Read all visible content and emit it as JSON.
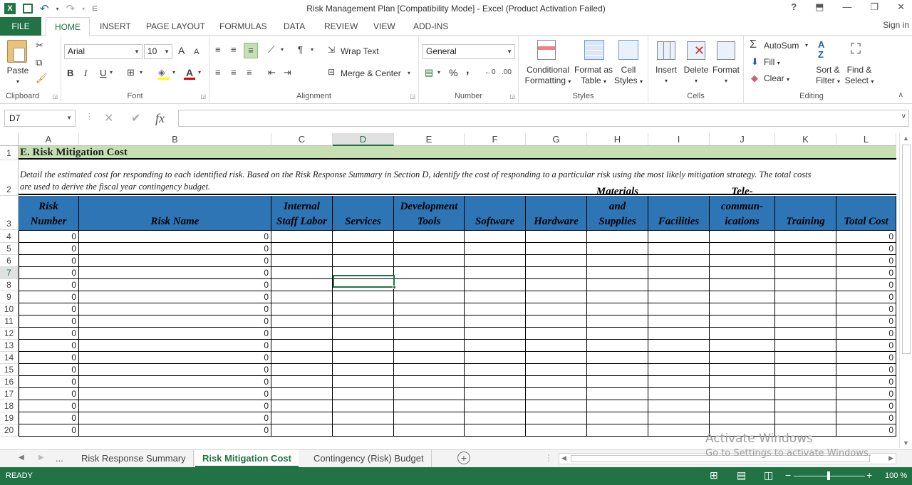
{
  "app": {
    "window_title": "Risk Management Plan  [Compatibility Mode] - Excel (Product Activation Failed)",
    "help": "?",
    "sign_in": "Sign in"
  },
  "ribbon_tabs": [
    "FILE",
    "HOME",
    "INSERT",
    "PAGE LAYOUT",
    "FORMULAS",
    "DATA",
    "REVIEW",
    "VIEW",
    "ADD-INS"
  ],
  "ribbon": {
    "clipboard": {
      "paste": "Paste",
      "label": "Clipboard"
    },
    "font": {
      "name": "Arial",
      "size": "10",
      "bold": "B",
      "italic": "I",
      "underline": "U",
      "grow": "A",
      "shrink": "A",
      "label": "Font"
    },
    "alignment": {
      "wrap_text": "Wrap Text",
      "merge_center": "Merge & Center",
      "label": "Alignment"
    },
    "number": {
      "format": "General",
      "percent": "%",
      "comma": ",",
      "label": "Number"
    },
    "styles": {
      "conditional": "Conditional",
      "formatting": "Formatting",
      "format_as": "Format as",
      "table": "Table",
      "cell": "Cell",
      "cell_styles": "Styles",
      "label": "Styles"
    },
    "cells": {
      "insert": "Insert",
      "delete": "Delete",
      "format": "Format",
      "label": "Cells"
    },
    "editing": {
      "autosum": "AutoSum",
      "fill": "Fill",
      "clear": "Clear",
      "sort": "Sort &",
      "filter": "Filter",
      "find": "Find &",
      "select": "Select",
      "label": "Editing"
    }
  },
  "formula_bar": {
    "name_box": "D7",
    "fx": "fx",
    "formula": ""
  },
  "columns": [
    "A",
    "B",
    "C",
    "D",
    "E",
    "F",
    "G",
    "H",
    "I",
    "J",
    "K",
    "L"
  ],
  "selected_column": "D",
  "sheet": {
    "title": "E.  Risk Mitigation Cost",
    "description_line1": "Detail the estimated cost for responding to each identified risk.  Based on the Risk Response Summary in Section D, identify the cost of responding to a particular risk using the most likely mitigation strategy.  The total costs",
    "description_line2": "are used to derive the fiscal year contingency budget.",
    "headers": [
      [
        "Risk",
        "Number"
      ],
      [
        "Risk Name"
      ],
      [
        "Internal",
        "Staff Labor"
      ],
      [
        "Services"
      ],
      [
        "Development",
        "Tools"
      ],
      [
        "Software"
      ],
      [
        "Hardware"
      ],
      [
        "Materials",
        "and",
        "Supplies"
      ],
      [
        "Facilities"
      ],
      [
        "Tele-",
        "commun-",
        "ications"
      ],
      [
        "Training"
      ],
      [
        "Total Cost"
      ]
    ],
    "rows": [
      {
        "num": "4",
        "a": "0",
        "b": "0",
        "l": "0"
      },
      {
        "num": "5",
        "a": "0",
        "b": "0",
        "l": "0"
      },
      {
        "num": "6",
        "a": "0",
        "b": "0",
        "l": "0"
      },
      {
        "num": "7",
        "a": "0",
        "b": "0",
        "l": "0"
      },
      {
        "num": "8",
        "a": "0",
        "b": "0",
        "l": "0"
      },
      {
        "num": "9",
        "a": "0",
        "b": "0",
        "l": "0"
      },
      {
        "num": "10",
        "a": "0",
        "b": "0",
        "l": "0"
      },
      {
        "num": "11",
        "a": "0",
        "b": "0",
        "l": "0"
      },
      {
        "num": "12",
        "a": "0",
        "b": "0",
        "l": "0"
      },
      {
        "num": "13",
        "a": "0",
        "b": "0",
        "l": "0"
      },
      {
        "num": "14",
        "a": "0",
        "b": "0",
        "l": "0"
      },
      {
        "num": "15",
        "a": "0",
        "b": "0",
        "l": "0"
      },
      {
        "num": "16",
        "a": "0",
        "b": "0",
        "l": "0"
      },
      {
        "num": "17",
        "a": "0",
        "b": "0",
        "l": "0"
      },
      {
        "num": "18",
        "a": "0",
        "b": "0",
        "l": "0"
      },
      {
        "num": "19",
        "a": "0",
        "b": "0",
        "l": "0"
      },
      {
        "num": "20",
        "a": "0",
        "b": "0",
        "l": "0"
      }
    ],
    "row_labels_top": [
      "1",
      "2",
      "3"
    ],
    "active_row": "7"
  },
  "sheet_tabs": {
    "ellipsis": "...",
    "tabs": [
      "Risk Response Summary",
      "Risk Mitigation Cost",
      "Contingency (Risk) Budget"
    ],
    "active": "Risk Mitigation Cost"
  },
  "status": {
    "ready": "READY",
    "zoom": "100 %"
  },
  "watermark": {
    "line1": "Activate Windows",
    "line2": "Go to Settings to activate Windows."
  },
  "colors": {
    "excel_green": "#217346",
    "header_blue": "#2e75b6",
    "title_green": "#c6e0b4"
  },
  "icons": [
    "excel-logo-icon",
    "save-icon",
    "undo-icon",
    "redo-icon",
    "paste-icon",
    "cut-icon",
    "copy-icon",
    "format-painter-icon",
    "borders-icon",
    "fill-color-icon",
    "font-color-icon",
    "insert-function-icon",
    "new-sheet-icon"
  ]
}
